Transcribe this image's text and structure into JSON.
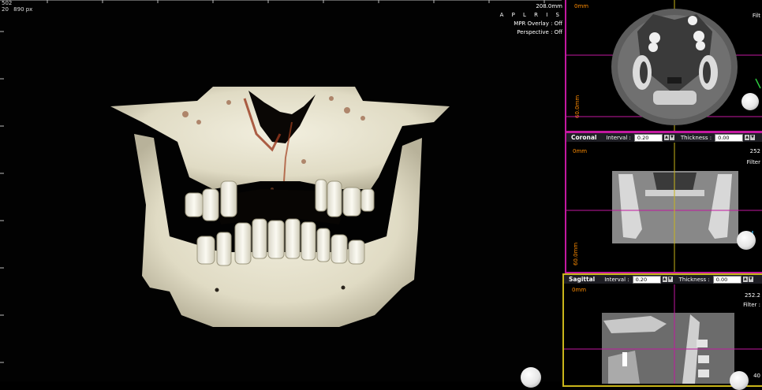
{
  "view3d": {
    "corner_lines": [
      "502",
      "20",
      "890 px"
    ],
    "dimension": "208.0mm",
    "mode": "A P L R I S",
    "mpr_overlay": "MPR Overlay : Off",
    "perspective": "Perspective : Off"
  },
  "axial_panel": {
    "mm_top": "0mm",
    "filter": "Filt",
    "side_mm": "60.0mm",
    "border_color": "#c2189f"
  },
  "coronal_panel": {
    "title": "Coronal",
    "interval_label": "Interval :",
    "interval_value": "0.20 mm",
    "thickness_label": "Thickness :",
    "thickness_value": "0.00 mm",
    "mm_top": "0mm",
    "right_value": "252",
    "filter": "Filter",
    "side_mm": "60.0mm",
    "border_color": "#c2189f"
  },
  "sagittal_panel": {
    "title": "Sagittal",
    "interval_label": "Interval :",
    "interval_value": "0.20 mm",
    "thickness_label": "Thickness :",
    "thickness_value": "0.00 mm",
    "mm_top": "0mm",
    "right_value": "252.2",
    "filter": "Filter :",
    "bottom_right": "40",
    "border_color": "#c9b51a"
  }
}
